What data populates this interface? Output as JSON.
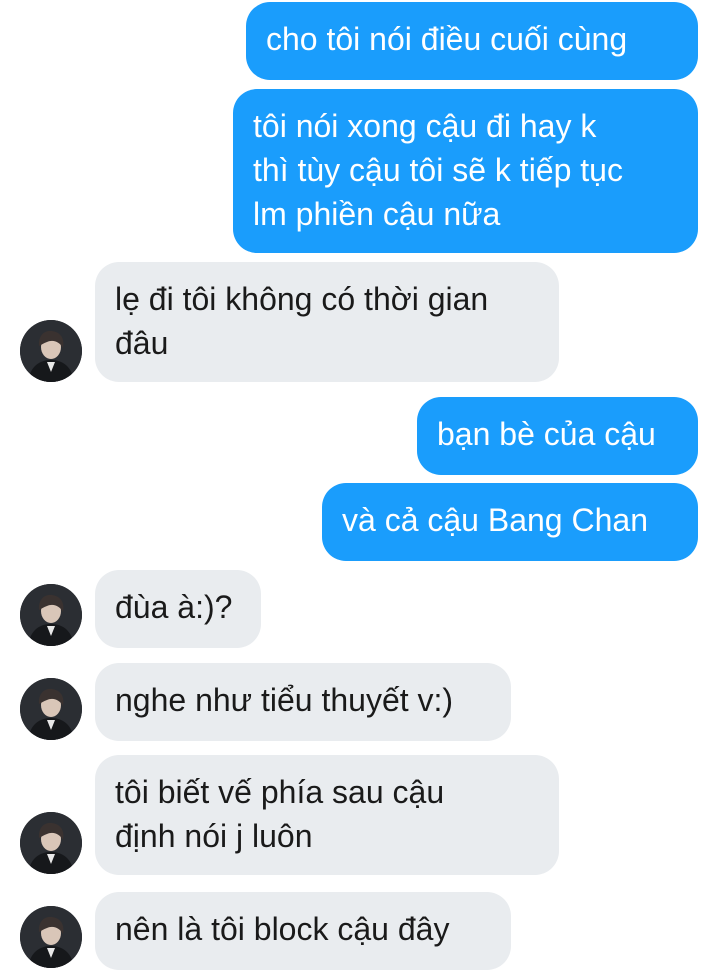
{
  "messages": [
    {
      "side": "sent",
      "text": "cho tôi nói điều cuối cùng"
    },
    {
      "side": "sent",
      "text": "tôi nói xong cậu đi hay k\nthì tùy cậu tôi sẽ k tiếp tục\nlm phiền cậu nữa"
    },
    {
      "side": "received",
      "text": "lẹ đi tôi không có thời gian\nđâu"
    },
    {
      "side": "sent",
      "text": "bạn bè của cậu"
    },
    {
      "side": "sent",
      "text": "và cả cậu Bang Chan"
    },
    {
      "side": "received",
      "text": "đùa à:)?"
    },
    {
      "side": "received",
      "text": "nghe như tiểu thuyết v:)"
    },
    {
      "side": "received",
      "text": "tôi biết vế phía sau cậu\nđịnh nói j luôn"
    },
    {
      "side": "received",
      "text": "nên là tôi block cậu đây"
    }
  ],
  "colors": {
    "sent_bubble": "#1a9dfc",
    "received_bubble": "#e9ecef",
    "sent_text": "#ffffff",
    "received_text": "#1a1a1a"
  },
  "icons": {
    "contact_avatar": "contact-avatar-photo"
  }
}
